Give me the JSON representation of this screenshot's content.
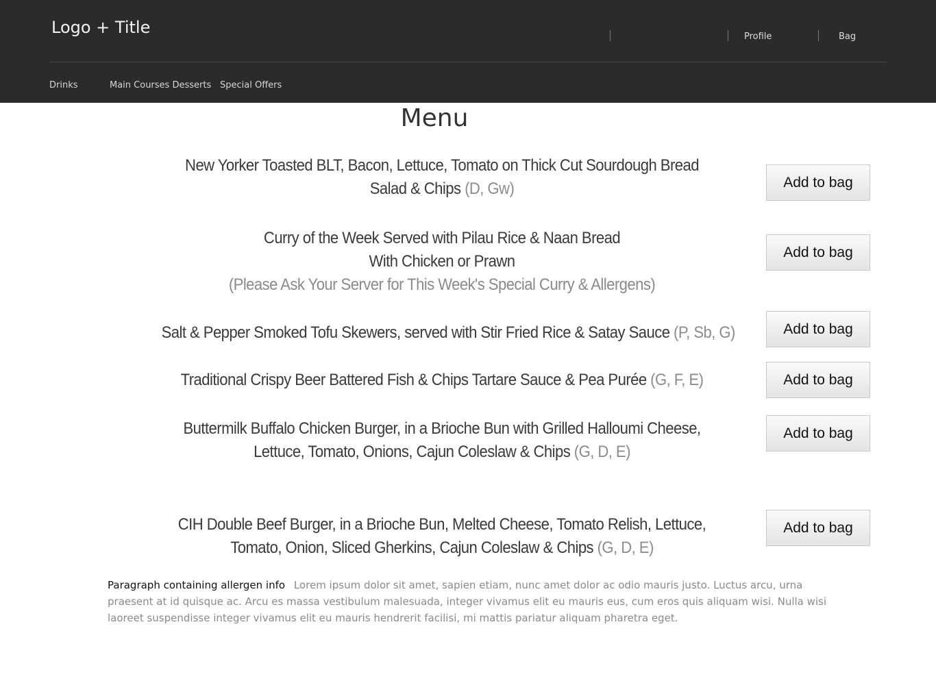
{
  "header": {
    "logo_title": "Logo + Title",
    "top_links": {
      "profile": "Profile",
      "bag": "Bag"
    },
    "nav": [
      "Drinks",
      "Main Courses Desserts",
      "Special Offers"
    ]
  },
  "page_title": "Menu",
  "items": [
    {
      "lines": [
        "New Yorker Toasted BLT, Bacon, Lettuce, Tomato on Thick Cut Sourdough Bread",
        "Salad & Chips"
      ],
      "allergens": "(D, Gw)",
      "note": "",
      "button": "Add to bag"
    },
    {
      "lines": [
        "Curry of the Week Served with Pilau Rice & Naan Bread",
        "With Chicken or Prawn"
      ],
      "allergens": "",
      "note": "(Please Ask Your Server for This Week's Special Curry & Allergens)",
      "button": "Add to bag"
    },
    {
      "lines": [
        "Salt & Pepper Smoked Tofu Skewers, served with Stir Fried Rice & Satay Sauce"
      ],
      "allergens": "(P, Sb, G)",
      "note": "",
      "button": "Add to bag"
    },
    {
      "lines": [
        "Traditional Crispy Beer Battered Fish & Chips Tartare Sauce & Pea Purée"
      ],
      "allergens": "(G, F, E)",
      "note": "",
      "button": "Add to bag"
    },
    {
      "lines": [
        "Buttermilk Buffalo Chicken Burger, in a Brioche Bun with Grilled Halloumi Cheese,",
        "Lettuce, Tomato, Onions, Cajun Coleslaw & Chips"
      ],
      "allergens": "(G, D, E)",
      "note": "",
      "button": "Add to bag"
    },
    {
      "lines": [
        "CIH Double Beef Burger, in a Brioche Bun, Melted Cheese, Tomato Relish, Lettuce,",
        "Tomato, Onion, Sliced Gherkins, Cajun Coleslaw & Chips"
      ],
      "allergens": "(G, D, E)",
      "note": "",
      "button": "Add to bag"
    }
  ],
  "allergen_info": {
    "lead": "Paragraph containing allergen info",
    "text": "Lorem ipsum dolor sit amet, sapien etiam, nunc amet dolor ac odio mauris justo. Luctus arcu, urna praesent at id quisque ac. Arcu es massa vestibulum malesuada, integer vivamus elit eu mauris eus, cum eros quis aliquam wisi. Nulla wisi laoreet suspendisse integer vivamus elit eu mauris hendrerit facilisi, mi mattis pariatur aliquam pharetra eget."
  }
}
